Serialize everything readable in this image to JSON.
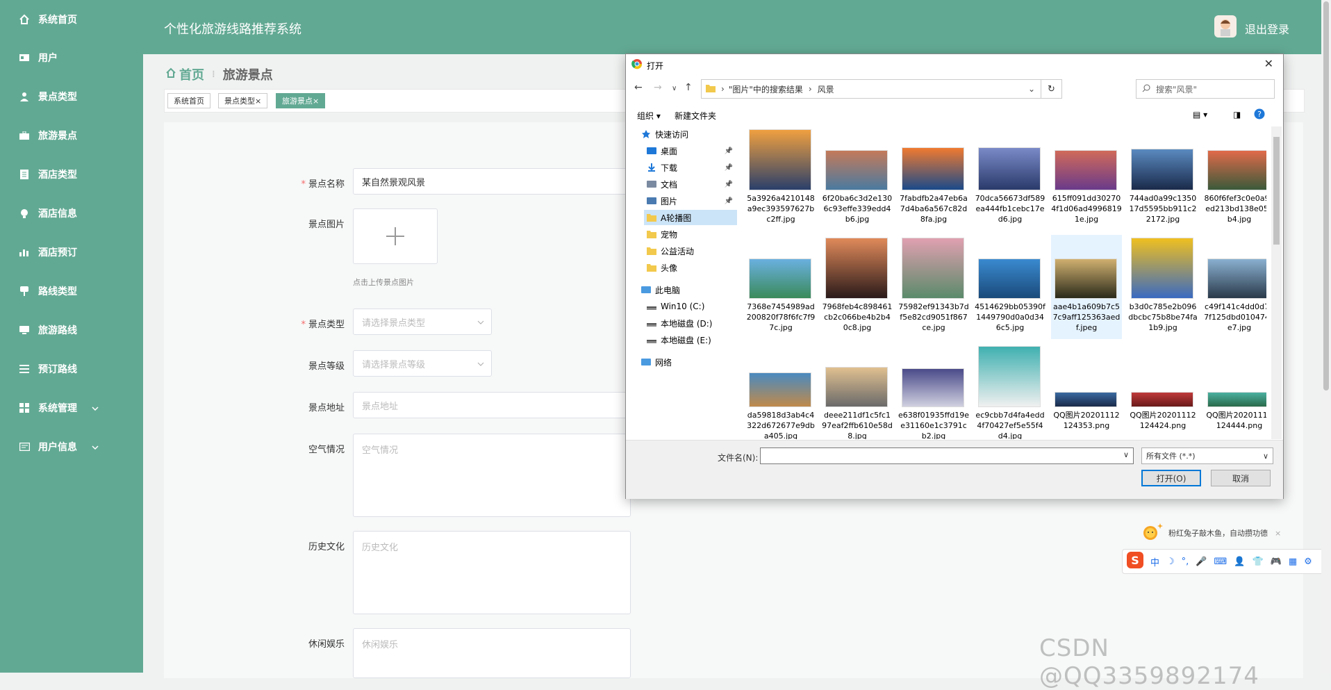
{
  "app": {
    "title": "个性化旅游线路推荐系统",
    "logout": "退出登录"
  },
  "sidebar": {
    "items": [
      {
        "label": "系统首页",
        "icon": "home-icon"
      },
      {
        "label": "用户",
        "icon": "user-card-icon"
      },
      {
        "label": "景点类型",
        "icon": "person-icon"
      },
      {
        "label": "旅游景点",
        "icon": "briefcase-icon"
      },
      {
        "label": "酒店类型",
        "icon": "document-icon"
      },
      {
        "label": "酒店信息",
        "icon": "bulb-icon"
      },
      {
        "label": "酒店预订",
        "icon": "bar-chart-icon"
      },
      {
        "label": "路线类型",
        "icon": "sign-icon"
      },
      {
        "label": "旅游路线",
        "icon": "monitor-icon"
      },
      {
        "label": "预订路线",
        "icon": "list-icon"
      },
      {
        "label": "系统管理",
        "icon": "grid-icon"
      },
      {
        "label": "用户信息",
        "icon": "id-card-icon"
      }
    ]
  },
  "breadcrumb": {
    "home": "首页",
    "current": "旅游景点"
  },
  "tags": [
    {
      "label": "系统首页",
      "active": false,
      "close": ""
    },
    {
      "label": "景点类型",
      "active": false,
      "close": "×"
    },
    {
      "label": "旅游景点",
      "active": true,
      "close": "×"
    }
  ],
  "form": {
    "name_label": "景点名称",
    "name_value": "某自然景观风景",
    "image_label": "景点图片",
    "image_hint": "点击上传景点图片",
    "type_label": "景点类型",
    "type_placeholder": "请选择景点类型",
    "level_label": "景点等级",
    "level_placeholder": "请选择景点等级",
    "address_label": "景点地址",
    "address_placeholder": "景点地址",
    "air_label": "空气情况",
    "air_placeholder": "空气情况",
    "history_label": "历史文化",
    "history_placeholder": "历史文化",
    "leisure_label": "休闲娱乐",
    "leisure_placeholder": "休闲娱乐"
  },
  "dialog": {
    "title": "打开",
    "address": [
      "\"图片\"中的搜索结果",
      "风景"
    ],
    "search_placeholder": "搜索\"风景\"",
    "organize": "组织 ▾",
    "new_folder": "新建文件夹",
    "tree": [
      {
        "label": "快速访问",
        "level": 0,
        "icon": "star-icon",
        "pin": false
      },
      {
        "label": "桌面",
        "level": 1,
        "icon": "desktop-icon",
        "pin": true
      },
      {
        "label": "下载",
        "level": 1,
        "icon": "download-icon",
        "pin": true
      },
      {
        "label": "文档",
        "level": 1,
        "icon": "document-icon",
        "pin": true
      },
      {
        "label": "图片",
        "level": 1,
        "icon": "picture-icon",
        "pin": true
      },
      {
        "label": "A轮播图",
        "level": 1,
        "icon": "folder-icon",
        "pin": false,
        "selected": true
      },
      {
        "label": "宠物",
        "level": 1,
        "icon": "folder-icon",
        "pin": false
      },
      {
        "label": "公益活动",
        "level": 1,
        "icon": "folder-icon",
        "pin": false
      },
      {
        "label": "头像",
        "level": 1,
        "icon": "folder-icon",
        "pin": false
      },
      {
        "label": "此电脑",
        "level": 0,
        "icon": "computer-icon",
        "pin": false
      },
      {
        "label": "Win10 (C:)",
        "level": 1,
        "icon": "drive-icon",
        "pin": false
      },
      {
        "label": "本地磁盘 (D:)",
        "level": 1,
        "icon": "drive-icon",
        "pin": false
      },
      {
        "label": "本地磁盘 (E:)",
        "level": 1,
        "icon": "drive-icon",
        "pin": false
      },
      {
        "label": "网络",
        "level": 0,
        "icon": "network-icon",
        "pin": false
      }
    ],
    "files": [
      {
        "name": "5a3926a4210148a9ec393597627bc2ff.jpg",
        "colors": [
          "#f0a040",
          "#2a3f6a"
        ]
      },
      {
        "name": "6f20ba6c3d2e1306c93effe339edd4b6.jpg",
        "colors": [
          "#c47a5a",
          "#4a7aa0"
        ]
      },
      {
        "name": "7fabdfb2a47eb6a7d4ba6a567c82d8fa.jpg",
        "colors": [
          "#f07a30",
          "#1a4a8a"
        ]
      },
      {
        "name": "70dca56673df589ea444fb1cebc17ed6.jpg",
        "colors": [
          "#7a8ac8",
          "#2a3a6a"
        ]
      },
      {
        "name": "615ff091dd302704f1d06ad49968191e.jpg",
        "colors": [
          "#d06a5a",
          "#6a3a8a"
        ]
      },
      {
        "name": "744ad0a99c135017d5595bb911c22172.jpg",
        "colors": [
          "#5a8ac0",
          "#1a2a4a"
        ]
      },
      {
        "name": "860f6fef3c0e0a9ded213bd138e052b4.jpg",
        "colors": [
          "#e06a4a",
          "#3a5a3a"
        ]
      },
      {
        "name": "7368e7454989ad200820f78f6fc7f97c.jpg",
        "colors": [
          "#6ab0e0",
          "#3a8a5a"
        ]
      },
      {
        "name": "7968feb4c898461cb2c066be4b2b40c8.jpg",
        "colors": [
          "#e08a5a",
          "#2a1a1a"
        ]
      },
      {
        "name": "75982ef91343b7df5e82cd9051f867ce.jpg",
        "colors": [
          "#e0a0b0",
          "#5a8a6a"
        ]
      },
      {
        "name": "4514629bb05390f1449790d0a0d346c5.jpg",
        "colors": [
          "#3a8ad0",
          "#1a4a7a"
        ]
      },
      {
        "name": "aae4b1a609b7c57c9aff125363aedf.jpeg",
        "colors": [
          "#d0b070",
          "#2a2a1a"
        ]
      },
      {
        "name": "b3d0c785e2b096dbcbc75b8be74fa1b9.jpg",
        "colors": [
          "#f0c020",
          "#3a6ac0"
        ]
      },
      {
        "name": "c49f141c4dd0d767f125dbd0104746e7.jpg",
        "colors": [
          "#8ab0d0",
          "#2a3a4a"
        ]
      },
      {
        "name": "da59818d3ab4c4322d672677e9dba405.jpg",
        "colors": [
          "#4a8ac0",
          "#c08a4a"
        ]
      },
      {
        "name": "deee211df1c5fc197eaf2ffb610e58d8.jpg",
        "colors": [
          "#e0c090",
          "#6a6a6a"
        ]
      },
      {
        "name": "e638f01935ffd19ee31160e1c3791cb2.jpg",
        "colors": [
          "#4a4a8a",
          "#d0d0e0"
        ]
      },
      {
        "name": "ec9cbb7d4fa4edd4f70427ef5e55f4d4.jpg",
        "colors": [
          "#40b0b0",
          "#f0f0f0"
        ]
      },
      {
        "name": "QQ图片20201112124353.png",
        "colors": [
          "#3a6aa0",
          "#1a2a4a"
        ]
      },
      {
        "name": "QQ图片20201112124424.png",
        "colors": [
          "#c03a3a",
          "#6a1a1a"
        ]
      },
      {
        "name": "QQ图片20201112124444.png",
        "colors": [
          "#4ab0a0",
          "#2a6a4a"
        ]
      }
    ],
    "filename_label": "文件名(N):",
    "filename_value": "",
    "filetype": "所有文件 (*.*)",
    "open_button": "打开(O)",
    "cancel_button": "取消"
  },
  "ime": {
    "tip": "粉红兔子敲木鱼，自动攒功德",
    "tip_close": "×",
    "items": [
      "中",
      "☽",
      "°,",
      "🎤",
      "⌨",
      "👤",
      "👕",
      "🎮",
      "▦",
      "⚙"
    ]
  },
  "watermark": "CSDN @QQ3359892174"
}
